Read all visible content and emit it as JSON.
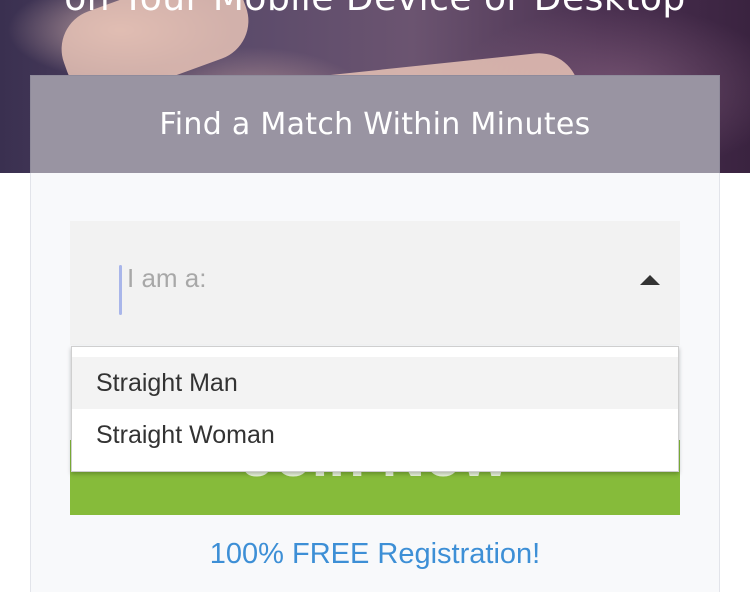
{
  "hero": {
    "headline": "on Your Mobile Device or Desktop"
  },
  "card": {
    "header_title": "Find a Match Within Minutes"
  },
  "form": {
    "select_placeholder": "I am a:",
    "options": [
      {
        "label": "Straight Man",
        "highlighted": true
      },
      {
        "label": "Straight Woman",
        "highlighted": false
      }
    ],
    "join_button_label": "Join Now"
  },
  "footer": {
    "free_registration_link": "100% FREE Registration!"
  },
  "colors": {
    "join_button": "#86bb3a",
    "link": "#3d8fd6",
    "caret": "#a9b6ea"
  },
  "icons": {
    "select_arrow": "caret-up-icon"
  }
}
